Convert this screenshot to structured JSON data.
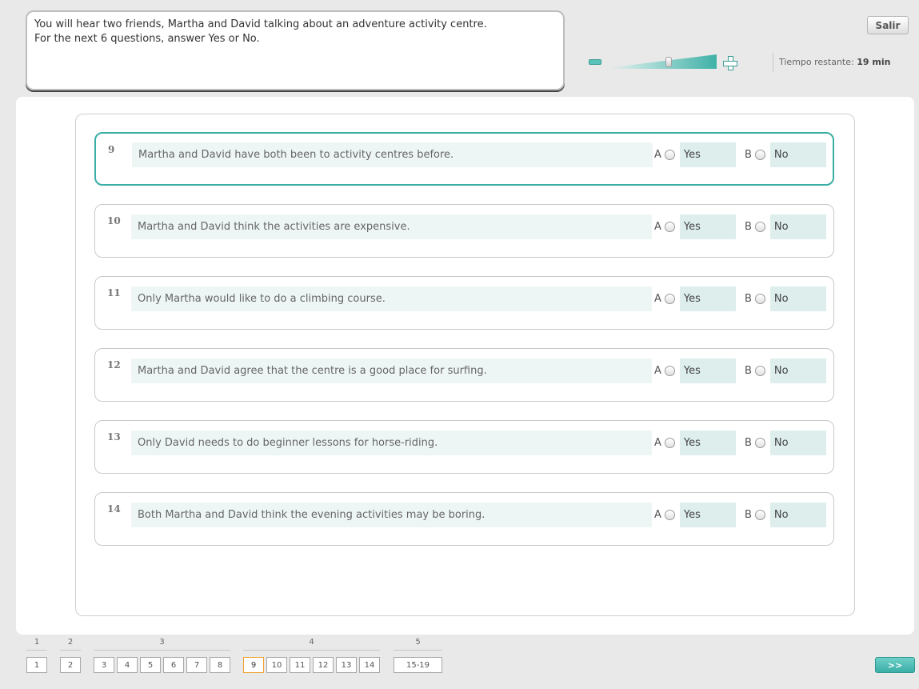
{
  "instructions": {
    "line1": "You will hear two friends, Martha and David talking about an adventure activity centre.",
    "line2": "For the next 6 questions, answer Yes or No."
  },
  "header": {
    "exit_label": "Salir",
    "timer_label": "Tiempo restante:",
    "timer_value": "19 min",
    "volume_level": 0.55
  },
  "questions": [
    {
      "number": "9",
      "text": "Martha and David have both been to activity centres before.",
      "option_a_letter": "A",
      "option_a": "Yes",
      "option_b_letter": "B",
      "option_b": "No",
      "active": true
    },
    {
      "number": "10",
      "text": "Martha and David think the activities are expensive.",
      "option_a_letter": "A",
      "option_a": "Yes",
      "option_b_letter": "B",
      "option_b": "No"
    },
    {
      "number": "11",
      "text": "Only Martha would like to do a climbing course.",
      "option_a_letter": "A",
      "option_a": "Yes",
      "option_b_letter": "B",
      "option_b": "No"
    },
    {
      "number": "12",
      "text": "Martha and David agree that the centre is a good place for surfing.",
      "option_a_letter": "A",
      "option_a": "Yes",
      "option_b_letter": "B",
      "option_b": "No"
    },
    {
      "number": "13",
      "text": "Only David needs to do beginner lessons for horse-riding.",
      "option_a_letter": "A",
      "option_a": "Yes",
      "option_b_letter": "B",
      "option_b": "No"
    },
    {
      "number": "14",
      "text": "Both Martha and David think the evening activities may be boring.",
      "option_a_letter": "A",
      "option_a": "Yes",
      "option_b_letter": "B",
      "option_b": "No"
    }
  ],
  "navigation": {
    "parts": [
      {
        "label": "1",
        "buttons": [
          "1"
        ]
      },
      {
        "label": "2",
        "buttons": [
          "2"
        ]
      },
      {
        "label": "3",
        "buttons": [
          "3",
          "4",
          "5",
          "6",
          "7",
          "8"
        ]
      },
      {
        "label": "4",
        "buttons": [
          "9",
          "10",
          "11",
          "12",
          "13",
          "14"
        ]
      },
      {
        "label": "5",
        "buttons": [
          "15-19"
        ]
      }
    ],
    "current": "9",
    "next_label": ">>"
  },
  "colors": {
    "accent": "#3aaea5",
    "current_page_border": "#f0a030"
  },
  "icons": {
    "volume_down": "minus-icon",
    "volume_up": "plus-icon",
    "next": "double-chevron-right-icon"
  }
}
